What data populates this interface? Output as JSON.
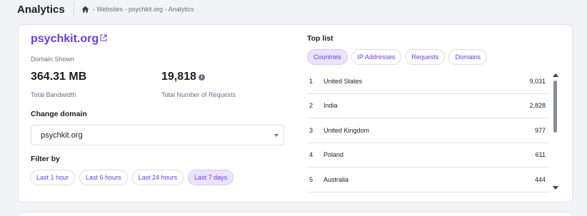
{
  "header": {
    "title": "Analytics",
    "breadcrumb": {
      "home_icon": "home-icon",
      "path": "- Websites - psychkit.org - Analytics"
    }
  },
  "domain": {
    "name": "psychkit.org",
    "shown_label": "Domain Shown",
    "link_icon": "external-link-icon"
  },
  "metrics": {
    "bandwidth": {
      "value": "364.31 MB",
      "label": "Total Bandwidth"
    },
    "requests": {
      "value": "19,818",
      "label": "Total Number of Requests",
      "icon": "info-icon"
    }
  },
  "change_domain": {
    "label": "Change domain",
    "selected": "psychkit.org"
  },
  "filter": {
    "label": "Filter by",
    "options": [
      "Last 1 hour",
      "Last 6 hours",
      "Last 24 hours",
      "Last 7 days"
    ],
    "active_index": 3
  },
  "top_list": {
    "label": "Top list",
    "tabs": [
      "Countries",
      "IP Addresses",
      "Requests",
      "Domains"
    ],
    "active_tab": 0,
    "rows": [
      {
        "rank": "1",
        "name": "United States",
        "count": "9,031"
      },
      {
        "rank": "2",
        "name": "India",
        "count": "2,828"
      },
      {
        "rank": "3",
        "name": "United Kingdom",
        "count": "977"
      },
      {
        "rank": "4",
        "name": "Poland",
        "count": "611"
      },
      {
        "rank": "5",
        "name": "Australia",
        "count": "444"
      }
    ]
  },
  "colors": {
    "accent": "#673de6",
    "pill_active_bg": "#ebe4ff",
    "page_bg": "#f2f3f6"
  }
}
